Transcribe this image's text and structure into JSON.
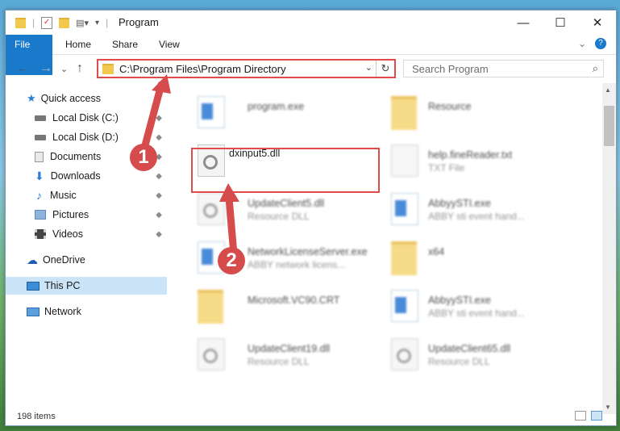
{
  "window": {
    "title": "Program",
    "controls": {
      "minimize": "—",
      "maximize": "☐",
      "close": "✕"
    }
  },
  "ribbon": {
    "tabs": [
      "File",
      "Home",
      "Share",
      "View"
    ],
    "help": "?",
    "expand": "⌄"
  },
  "nav": {
    "back": "←",
    "forward": "→",
    "dropdown": "⌄",
    "up": "↑",
    "address": "C:\\Program Files\\Program Directory",
    "address_dd": "⌄",
    "refresh": "↻",
    "search_placeholder": "Search Program",
    "search_icon": "⌕"
  },
  "sidebar": {
    "items": [
      {
        "label": "Quick access",
        "icon": "star-icon",
        "color": "#2b7cd3"
      },
      {
        "label": "Local Disk (C:)",
        "icon": "drive-icon",
        "color": "#666666",
        "pin": "📌"
      },
      {
        "label": "Local Disk (D:)",
        "icon": "drive-icon",
        "color": "#666666",
        "pin": "📌"
      },
      {
        "label": "Documents",
        "icon": "document-icon",
        "color": "#9a9a9a",
        "pin": "📌"
      },
      {
        "label": "Downloads",
        "icon": "download-icon",
        "color": "#2b7cd3",
        "pin": "📌"
      },
      {
        "label": "Music",
        "icon": "music-icon",
        "color": "#2b7cd3",
        "pin": "📌"
      },
      {
        "label": "Pictures",
        "icon": "pictures-icon",
        "color": "#5b8cc0",
        "pin": "📌"
      },
      {
        "label": "Videos",
        "icon": "video-icon",
        "color": "#444444",
        "pin": "📌"
      },
      {
        "label": "OneDrive",
        "icon": "cloud-icon",
        "color": "#1d5fb8"
      },
      {
        "label": "This PC",
        "icon": "computer-icon",
        "color": "#3a8ed8",
        "selected": true
      },
      {
        "label": "Network",
        "icon": "network-icon",
        "color": "#3a8ed8"
      }
    ]
  },
  "files": [
    {
      "name": "program.exe",
      "type": "",
      "kind": "app"
    },
    {
      "name": "Resource",
      "type": "",
      "kind": "folder"
    },
    {
      "name": "dxinput5.dll",
      "type": "",
      "kind": "doc",
      "highlighted": true
    },
    {
      "name": "help.fineReader.txt",
      "type": "TXT File",
      "kind": "doc"
    },
    {
      "name": "UpdateClient5.dll",
      "type": "Resource DLL",
      "kind": "doc"
    },
    {
      "name": "AbbyySTI.exe",
      "type": "ABBY sti event hand...",
      "kind": "app"
    },
    {
      "name": "NetworkLicenseServer.exe",
      "type": "ABBY network licens...",
      "kind": "app"
    },
    {
      "name": "x64",
      "type": "",
      "kind": "folder"
    },
    {
      "name": "Microsoft.VC90.CRT",
      "type": "",
      "kind": "folder"
    },
    {
      "name": "AbbyySTI.exe",
      "type": "ABBY sti event hand...",
      "kind": "app"
    },
    {
      "name": "UpdateClient19.dll",
      "type": "Resource DLL",
      "kind": "doc"
    },
    {
      "name": "UpdateClient65.dll",
      "type": "Resource DLL",
      "kind": "doc"
    }
  ],
  "status": {
    "count": "198 items"
  },
  "annotations": {
    "badge1": "1",
    "badge2": "2",
    "color": "#d64b4b"
  }
}
